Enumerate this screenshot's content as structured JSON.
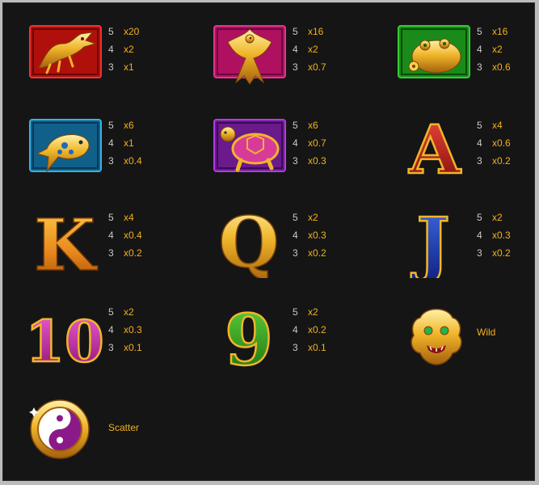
{
  "paytable": {
    "symbols": [
      {
        "id": "dragon",
        "icon": "dragon-icon",
        "pays": [
          {
            "count": "5",
            "mult": "x20"
          },
          {
            "count": "4",
            "mult": "x2"
          },
          {
            "count": "3",
            "mult": "x1"
          }
        ]
      },
      {
        "id": "phoenix",
        "icon": "phoenix-icon",
        "pays": [
          {
            "count": "5",
            "mult": "x16"
          },
          {
            "count": "4",
            "mult": "x2"
          },
          {
            "count": "3",
            "mult": "x0.7"
          }
        ]
      },
      {
        "id": "toad",
        "icon": "money-toad-icon",
        "pays": [
          {
            "count": "5",
            "mult": "x16"
          },
          {
            "count": "4",
            "mult": "x2"
          },
          {
            "count": "3",
            "mult": "x0.6"
          }
        ]
      },
      {
        "id": "koi",
        "icon": "koi-fish-icon",
        "pays": [
          {
            "count": "5",
            "mult": "x6"
          },
          {
            "count": "4",
            "mult": "x1"
          },
          {
            "count": "3",
            "mult": "x0.4"
          }
        ]
      },
      {
        "id": "turtle",
        "icon": "turtle-icon",
        "pays": [
          {
            "count": "5",
            "mult": "x6"
          },
          {
            "count": "4",
            "mult": "x0.7"
          },
          {
            "count": "3",
            "mult": "x0.3"
          }
        ]
      },
      {
        "id": "ace",
        "glyph": "A",
        "pays": [
          {
            "count": "5",
            "mult": "x4"
          },
          {
            "count": "4",
            "mult": "x0.6"
          },
          {
            "count": "3",
            "mult": "x0.2"
          }
        ]
      },
      {
        "id": "king",
        "glyph": "K",
        "pays": [
          {
            "count": "5",
            "mult": "x4"
          },
          {
            "count": "4",
            "mult": "x0.4"
          },
          {
            "count": "3",
            "mult": "x0.2"
          }
        ]
      },
      {
        "id": "queen",
        "glyph": "Q",
        "pays": [
          {
            "count": "5",
            "mult": "x2"
          },
          {
            "count": "4",
            "mult": "x0.3"
          },
          {
            "count": "3",
            "mult": "x0.2"
          }
        ]
      },
      {
        "id": "jack",
        "glyph": "J",
        "pays": [
          {
            "count": "5",
            "mult": "x2"
          },
          {
            "count": "4",
            "mult": "x0.3"
          },
          {
            "count": "3",
            "mult": "x0.2"
          }
        ]
      },
      {
        "id": "ten",
        "glyph": "10",
        "pays": [
          {
            "count": "5",
            "mult": "x2"
          },
          {
            "count": "4",
            "mult": "x0.3"
          },
          {
            "count": "3",
            "mult": "x0.1"
          }
        ]
      },
      {
        "id": "nine",
        "glyph": "9",
        "pays": [
          {
            "count": "5",
            "mult": "x2"
          },
          {
            "count": "4",
            "mult": "x0.2"
          },
          {
            "count": "3",
            "mult": "x0.1"
          }
        ]
      },
      {
        "id": "wild",
        "icon": "foo-dog-mask-icon",
        "label": "Wild"
      },
      {
        "id": "scatter",
        "icon": "yin-yang-icon",
        "label": "Scatter"
      }
    ]
  },
  "colors": {
    "multiplier": "#f2b01e",
    "count": "#c9c9c9",
    "background": "#151516"
  }
}
